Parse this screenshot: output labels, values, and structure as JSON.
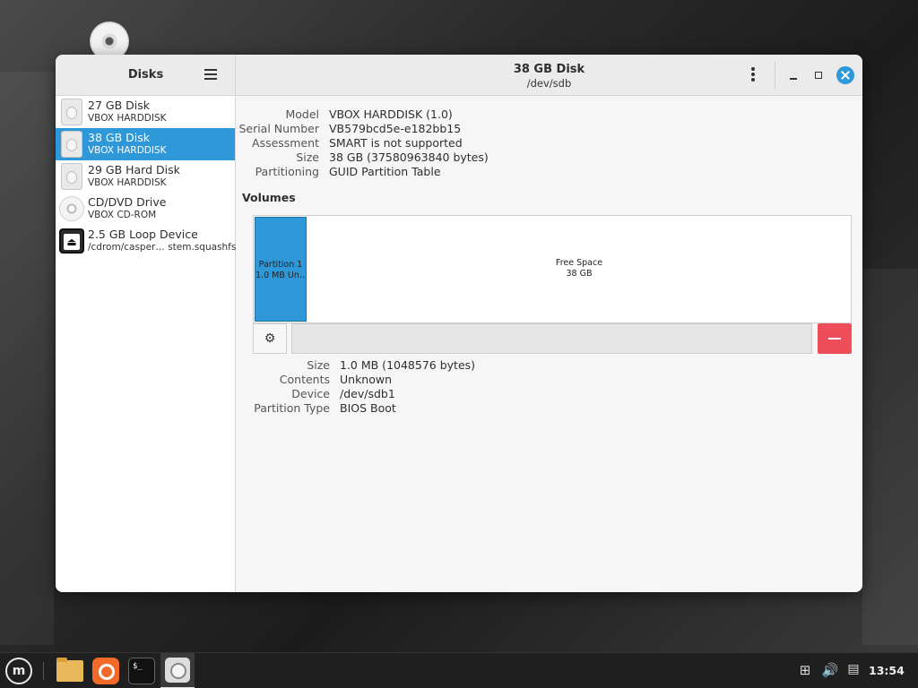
{
  "sidebar": {
    "title": "Disks",
    "items": [
      {
        "name": "27 GB Disk",
        "sub": "VBOX HARDDISK",
        "icon": "hard-disk-icon"
      },
      {
        "name": "38 GB Disk",
        "sub": "VBOX HARDDISK",
        "icon": "hard-disk-icon",
        "selected": true
      },
      {
        "name": "29 GB Hard Disk",
        "sub": "VBOX HARDDISK",
        "icon": "hard-disk-icon"
      },
      {
        "name": "CD/DVD Drive",
        "sub": "VBOX CD-ROM",
        "icon": "optical-disc-icon"
      },
      {
        "name": "2.5 GB Loop Device",
        "sub": "/cdrom/casper… stem.squashfs",
        "icon": "loop-device-icon"
      }
    ]
  },
  "header": {
    "title": "38 GB Disk",
    "subtitle": "/dev/sdb"
  },
  "disk_info": [
    {
      "label": "Model",
      "value": "VBOX HARDDISK (1.0)"
    },
    {
      "label": "Serial Number",
      "value": "VB579bcd5e-e182bb15"
    },
    {
      "label": "Assessment",
      "value": "SMART is not supported"
    },
    {
      "label": "Size",
      "value": "38 GB (37580963840 bytes)"
    },
    {
      "label": "Partitioning",
      "value": "GUID Partition Table"
    }
  ],
  "volumes": {
    "title": "Volumes",
    "partition": {
      "name": "Partition 1",
      "size": "1.0 MB Un…"
    },
    "free_space": {
      "name": "Free Space",
      "size": "38 GB"
    }
  },
  "partition_info": [
    {
      "label": "Size",
      "value": "1.0 MB (1048576 bytes)"
    },
    {
      "label": "Contents",
      "value": "Unknown"
    },
    {
      "label": "Device",
      "value": "/dev/sdb1"
    },
    {
      "label": "Partition Type",
      "value": "BIOS Boot"
    }
  ],
  "taskbar": {
    "apps": [
      "mint-menu-icon",
      "files-icon",
      "firefox-icon",
      "terminal-icon",
      "disks-icon"
    ],
    "terminal_glyph": "$_",
    "clock": "13:54"
  },
  "colors": {
    "accent": "#2f98d9",
    "delete": "#ee4e5a"
  }
}
